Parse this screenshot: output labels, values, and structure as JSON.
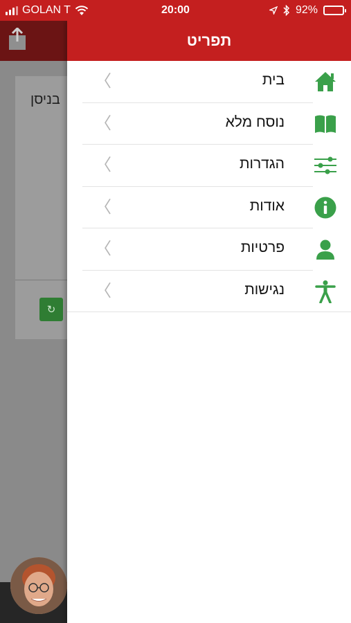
{
  "status_bar": {
    "carrier": "GOLAN T",
    "time": "20:00",
    "battery_percent": "92%",
    "battery_level": 0.92
  },
  "background": {
    "card_text": "בניסן"
  },
  "drawer": {
    "title": "תפריט",
    "items": [
      {
        "label": "בית",
        "icon": "home-icon"
      },
      {
        "label": "נוסח מלא",
        "icon": "book-icon"
      },
      {
        "label": "הגדרות",
        "icon": "sliders-icon"
      },
      {
        "label": "אודות",
        "icon": "info-icon"
      },
      {
        "label": "פרטיות",
        "icon": "user-icon"
      },
      {
        "label": "נגישות",
        "icon": "accessibility-icon"
      }
    ]
  },
  "colors": {
    "brand_red": "#c41f1f",
    "icon_green": "#3aa04a"
  }
}
